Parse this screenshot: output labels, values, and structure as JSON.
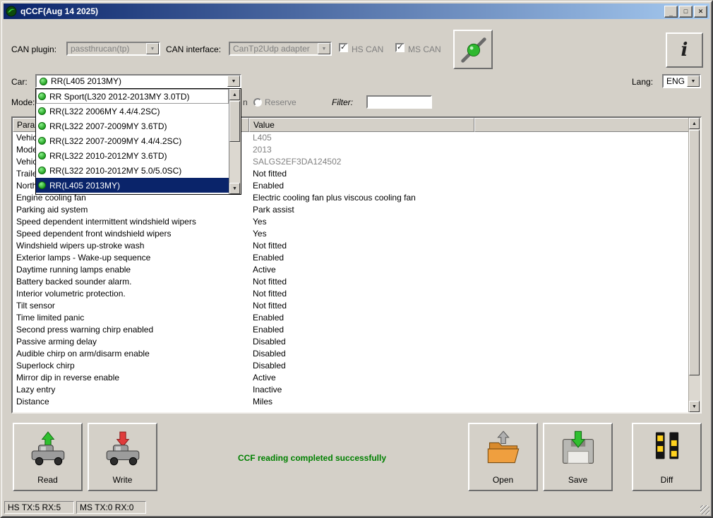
{
  "window": {
    "title": "qCCF(Aug 14 2025)",
    "controls": {
      "minimize": "_",
      "maximize": "□",
      "close": "✕"
    }
  },
  "toolbar": {
    "can_plugin_label": "CAN plugin:",
    "can_plugin_value": "passthrucan(tp)",
    "can_interface_label": "CAN interface:",
    "can_interface_value": "CanTp2Udp adapter",
    "hs_can_label": "HS CAN",
    "ms_can_label": "MS CAN",
    "hs_can_checked": true,
    "ms_can_checked": true,
    "info_label": "i"
  },
  "car_row": {
    "car_label": "Car:",
    "car_value": "RR(L405 2013MY)",
    "lang_label": "Lang:",
    "lang_value": "ENG"
  },
  "car_dropdown": {
    "items": [
      {
        "label": "RR Sport(L320 2012-2013MY 3.0TD)",
        "selected": false,
        "hot": true
      },
      {
        "label": "RR(L322 2006MY 4.4/4.2SC)",
        "selected": false
      },
      {
        "label": "RR(L322 2007-2009MY 3.6TD)",
        "selected": false
      },
      {
        "label": "RR(L322 2007-2009MY 4.4/4.2SC)",
        "selected": false
      },
      {
        "label": "RR(L322 2010-2012MY 3.6TD)",
        "selected": false
      },
      {
        "label": "RR(L322 2010-2012MY 5.0/5.0SC)",
        "selected": false
      },
      {
        "label": "RR(L405 2013MY)",
        "selected": true
      }
    ]
  },
  "mode_row": {
    "mode_label": "Mode:",
    "partial_option_label": "n",
    "reserve_label": "Reserve",
    "filter_label": "Filter:",
    "filter_value": ""
  },
  "table": {
    "headers": [
      "Parameter",
      "Value",
      ""
    ],
    "rows": [
      {
        "param": "Vehic",
        "value": "L405",
        "muted": true
      },
      {
        "param": "Mode",
        "value": "2013",
        "muted": true
      },
      {
        "param": "Vehic",
        "value": "SALGS2EF3DA124502",
        "muted": true
      },
      {
        "param": "Traile",
        "value": "Not fitted",
        "muted": false
      },
      {
        "param": "North",
        "value": "Enabled",
        "muted": false
      },
      {
        "param": "Engine cooling fan",
        "value": "Electric cooling fan plus viscous cooling fan",
        "muted": false
      },
      {
        "param": "Parking aid system",
        "value": "Park assist",
        "muted": false
      },
      {
        "param": "Speed dependent intermittent windshield wipers",
        "value": "Yes",
        "muted": false
      },
      {
        "param": "Speed dependent front windshield wipers",
        "value": "Yes",
        "muted": false
      },
      {
        "param": "Windshield wipers up-stroke wash",
        "value": "Not fitted",
        "muted": false
      },
      {
        "param": "Exterior lamps  -  Wake-up sequence",
        "value": "Enabled",
        "muted": false
      },
      {
        "param": "Daytime running lamps enable",
        "value": "Active",
        "muted": false
      },
      {
        "param": "Battery backed sounder alarm.",
        "value": "Not fitted",
        "muted": false
      },
      {
        "param": "Interior volumetric protection.",
        "value": "Not fitted",
        "muted": false
      },
      {
        "param": "Tilt sensor",
        "value": "Not fitted",
        "muted": false
      },
      {
        "param": "Time limited panic",
        "value": "Enabled",
        "muted": false
      },
      {
        "param": "Second press warning chirp enabled",
        "value": "Enabled",
        "muted": false
      },
      {
        "param": "Passive arming delay",
        "value": "Disabled",
        "muted": false
      },
      {
        "param": "Audible chirp on arm/disarm enable",
        "value": "Disabled",
        "muted": false
      },
      {
        "param": "Superlock chirp",
        "value": "Disabled",
        "muted": false
      },
      {
        "param": "Mirror dip in reverse enable",
        "value": "Active",
        "muted": false
      },
      {
        "param": "Lazy entry",
        "value": "Inactive",
        "muted": false
      },
      {
        "param": "Distance",
        "value": "Miles",
        "muted": false
      }
    ]
  },
  "actions": {
    "read_label": "Read",
    "write_label": "Write",
    "status_text": "CCF reading completed successfully",
    "open_label": "Open",
    "save_label": "Save",
    "diff_label": "Diff"
  },
  "statusbar": {
    "hs": "HS TX:5 RX:5",
    "ms": "MS TX:0 RX:0"
  },
  "colors": {
    "titlebar_start": "#0a246a",
    "titlebar_end": "#a6caf0",
    "selection": "#0a246a",
    "status_green": "#008000",
    "muted_text": "#808080",
    "chrome": "#d4d0c8",
    "ok_dot": "#1ea01e"
  }
}
